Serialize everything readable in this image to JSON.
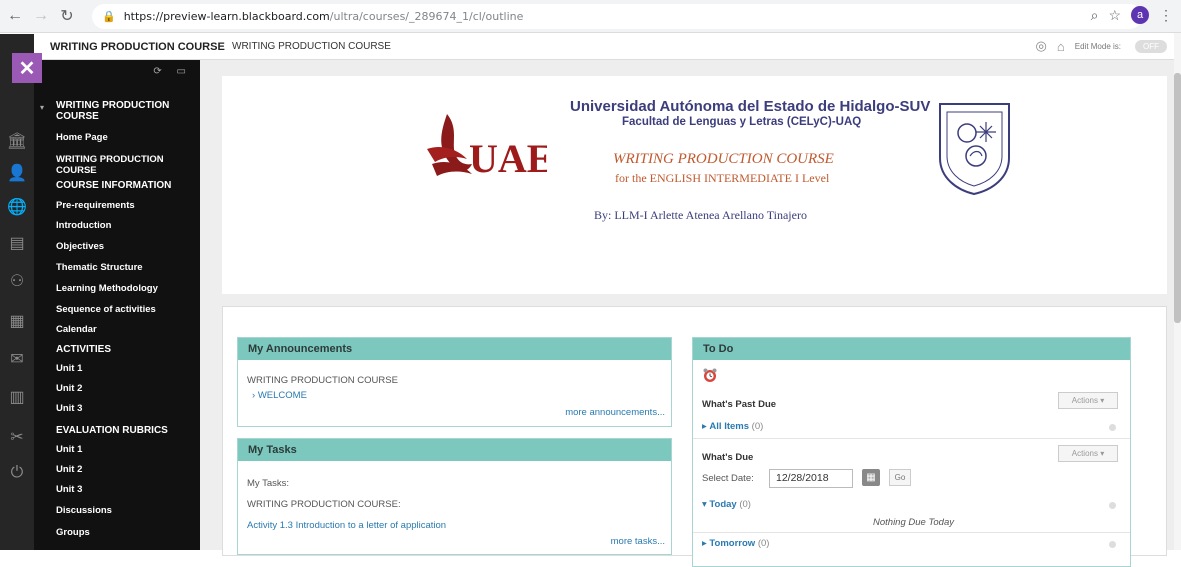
{
  "browser": {
    "url_host": "https://preview-learn.blackboard.com",
    "url_path": "/ultra/courses/_289674_1/cl/outline",
    "avatar_letter": "a"
  },
  "topbar": {
    "course_title": "WRITING PRODUCTION COURSE",
    "breadcrumb": "WRITING PRODUCTION COURSE",
    "edit_mode_label": "Edit Mode is:",
    "edit_mode_value": "OFF"
  },
  "menu": {
    "items": [
      {
        "label": "WRITING PRODUCTION COURSE",
        "style": "header"
      },
      {
        "label": "Home Page",
        "style": "bold"
      },
      {
        "label": "WRITING PRODUCTION COURSE",
        "style": "bold"
      },
      {
        "label": "COURSE INFORMATION",
        "style": "header"
      },
      {
        "label": "Pre-requirements",
        "style": "bold"
      },
      {
        "label": "Introduction",
        "style": "bold"
      },
      {
        "label": "Objectives",
        "style": "bold"
      },
      {
        "label": "Thematic Structure",
        "style": "bold"
      },
      {
        "label": "Learning Methodology",
        "style": "bold"
      },
      {
        "label": "Sequence of activities",
        "style": "bold"
      },
      {
        "label": "Calendar",
        "style": "bold"
      },
      {
        "label": "ACTIVITIES",
        "style": "header"
      },
      {
        "label": "Unit 1",
        "style": "bold"
      },
      {
        "label": "Unit 2",
        "style": "bold"
      },
      {
        "label": "Unit 3",
        "style": "bold"
      },
      {
        "label": "EVALUATION RUBRICS",
        "style": "header"
      },
      {
        "label": "Unit 1",
        "style": "bold"
      },
      {
        "label": "Unit 2",
        "style": "bold"
      },
      {
        "label": "Unit 3",
        "style": "bold"
      },
      {
        "label": "Discussions",
        "style": "bold"
      },
      {
        "label": "Groups",
        "style": "bold"
      }
    ]
  },
  "banner": {
    "logo_text": "UAEH",
    "university": "Universidad  Autónoma del Estado de Hidalgo-SUV",
    "faculty": "Facultad de Lenguas y Letras (CELyC)-UAQ",
    "course": "WRITING PRODUCTION COURSE",
    "level": "for the ENGLISH INTERMEDIATE I Level",
    "author": "By: LLM-I Arlette Atenea Arellano Tinajero"
  },
  "announcements": {
    "header": "My Announcements",
    "course": "WRITING PRODUCTION COURSE",
    "item": "WELCOME",
    "more": "more announcements..."
  },
  "tasks": {
    "header": "My Tasks",
    "label": "My Tasks:",
    "course": "WRITING PRODUCTION COURSE:",
    "item": "Activity 1.3 Introduction to a letter of application",
    "more": "more tasks..."
  },
  "todo": {
    "header": "To Do",
    "past_due_label": "What's Past Due",
    "all_items": "All Items",
    "all_items_count": "(0)",
    "due_label": "What's Due",
    "select_date_label": "Select Date:",
    "date_value": "12/28/2018",
    "go_label": "Go",
    "actions_label": "Actions",
    "today_label": "Today",
    "today_count": "(0)",
    "nothing_due": "Nothing Due Today",
    "tomorrow_label": "Tomorrow",
    "tomorrow_count": "(0)"
  },
  "colors": {
    "accent_purple": "#9b59b6",
    "module_header": "#7dc8be",
    "link": "#2a7ab0",
    "banner_navy": "#3c3d7c",
    "banner_orange": "#c05a2f"
  }
}
